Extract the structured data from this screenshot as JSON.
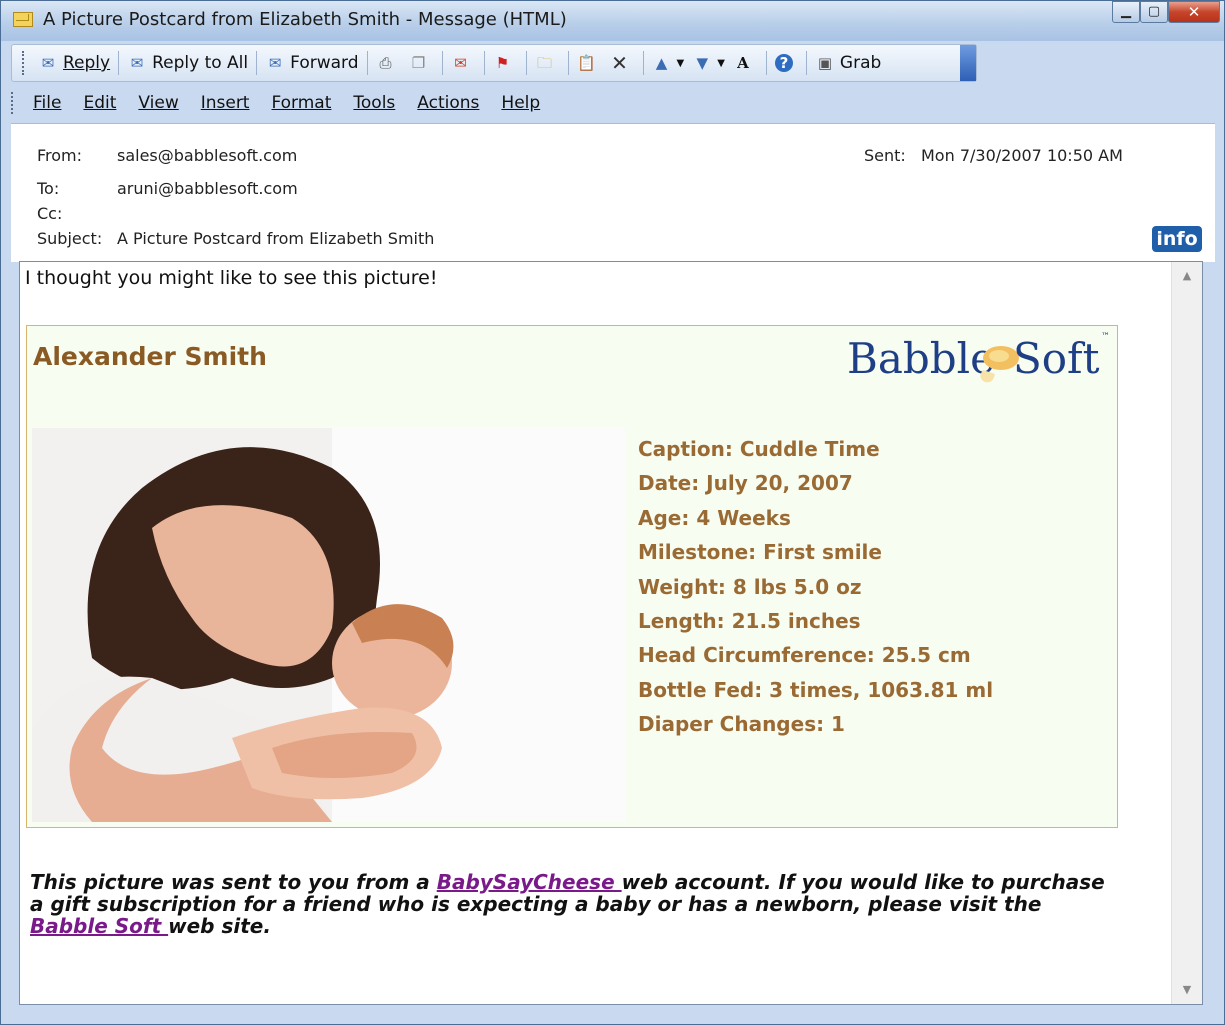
{
  "window": {
    "title": "A Picture Postcard from Elizabeth Smith - Message (HTML)"
  },
  "toolbar": {
    "reply": "Reply",
    "reply_all": "Reply to All",
    "forward": "Forward",
    "grab": "Grab"
  },
  "menu": [
    "File",
    "Edit",
    "View",
    "Insert",
    "Format",
    "Tools",
    "Actions",
    "Help"
  ],
  "headers": {
    "from_label": "From:",
    "from_value": "sales@babblesoft.com",
    "sent_label": "Sent:",
    "sent_value": "Mon 7/30/2007 10:50 AM",
    "to_label": "To:",
    "to_value": "aruni@babblesoft.com",
    "cc_label": "Cc:",
    "subject_label": "Subject:",
    "subject_value": "A Picture Postcard from Elizabeth Smith",
    "info_badge": "info"
  },
  "message": {
    "intro": "I thought you might like to see this picture!",
    "postcard": {
      "name": "Alexander Smith",
      "logo_left": "Babble",
      "logo_right": "Soft",
      "logo_tm": "™",
      "details": [
        "Caption: Cuddle Time",
        "Date: July 20, 2007",
        "Age: 4 Weeks",
        "Milestone: First smile",
        "Weight: 8 lbs 5.0 oz",
        "Length: 21.5 inches",
        "Head Circumference: 25.5 cm",
        "Bottle Fed: 3 times, 1063.81 ml",
        "Diaper Changes: 1"
      ]
    },
    "footer": {
      "part1": "This picture was sent to you from a ",
      "link1": "BabySayCheese ",
      "part2": "web account. If you would like to purchase a gift subscription for a friend who is expecting a baby or has a newborn, please visit the ",
      "link2": "Babble Soft ",
      "part3": "web site."
    }
  },
  "colors": {
    "accent_brown": "#9a6a34",
    "link_purple": "#7a1a8a",
    "logo_blue": "#1e3f86",
    "close_red": "#c7452a"
  }
}
